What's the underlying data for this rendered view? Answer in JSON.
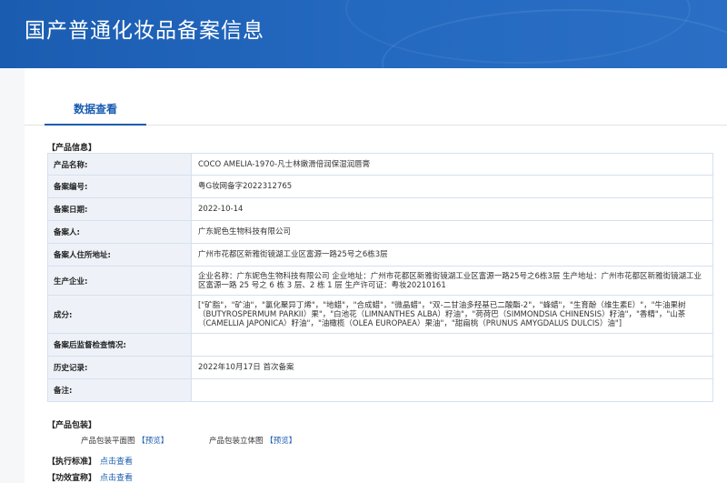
{
  "header": {
    "title": "国产普通化妆品备案信息"
  },
  "tabs": [
    {
      "label": "数据查看"
    }
  ],
  "sections": {
    "product_info": "【产品信息】",
    "packaging": "【产品包装】",
    "standard": "【执行标准】",
    "efficacy": "【功效宣称】"
  },
  "product_info": {
    "rows": [
      {
        "key": "产品名称:",
        "value": "COCO AMELIA-1970-凡士林嫩滑倍润保湿润唇膏"
      },
      {
        "key": "备案编号:",
        "value": "粤G妆网备字2022312765"
      },
      {
        "key": "备案日期:",
        "value": "2022-10-14"
      },
      {
        "key": "备案人:",
        "value": "广东妮色生物科技有限公司"
      },
      {
        "key": "备案人住所地址:",
        "value": "广州市花都区新雅街镜湖工业区富源一路25号之6栋3层"
      },
      {
        "key": "生产企业:",
        "value": "企业名称：广东妮色生物科技有限公司 企业地址：广州市花都区新雅街镜湖工业区富源一路25号之6栋3层 生产地址：广州市花都区新雅街镜湖工业区富源一路 25 号之 6 栋 3 层、2 栋 1 层 生产许可证：粤妆20210161"
      },
      {
        "key": "成分:",
        "value": "[\"矿脂\"，\"矿油\"，\"氯化聚异丁烯\"，\"地蜡\"，\"合成蜡\"，\"微晶蜡\"，\"双-二甘油多羟基已二酸酯-2\"，\"蜂蜡\"，\"生育酚（维生素E）\"，\"牛油果树（BUTYROSPERMUM PARKII）果\"，\"白池花（LIMNANTHES ALBA）籽油\"，\"荷荷巴（SIMMONDSIA CHINENSIS）籽油\"，\"香精\"，\"山茶（CAMELLIA JAPONICA）籽油\"，\"油橄榄（OLEA EUROPAEA）果油\"，\"甜扁桃（PRUNUS AMYGDALUS DULCIS）油\"]"
      },
      {
        "key": "备案后监督检查情况:",
        "value": ""
      },
      {
        "key": "历史记录:",
        "value": "2022年10月17日 首次备案"
      },
      {
        "key": "备注:",
        "value": ""
      }
    ]
  },
  "packaging": {
    "flat_label": "产品包装平面图",
    "flat_link": "【预览】",
    "solid_label": "产品包装立体图",
    "solid_link": "【预览】"
  },
  "links": {
    "view": "点击查看"
  }
}
